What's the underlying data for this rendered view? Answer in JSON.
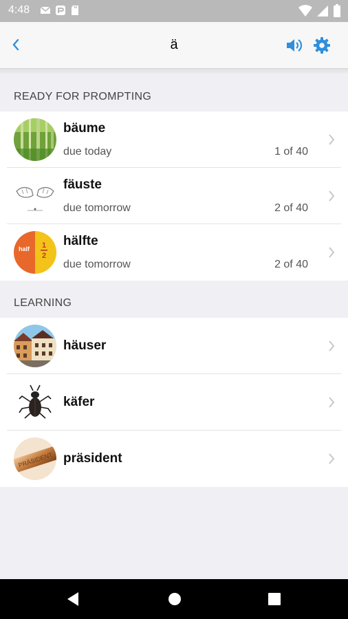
{
  "status_bar": {
    "time": "4:48",
    "left_icons": [
      "gmail-icon",
      "app-icon",
      "sd-card-icon"
    ],
    "right_icons": [
      "wifi-icon",
      "signal-icon",
      "battery-icon"
    ]
  },
  "header": {
    "title": "ä",
    "back_icon": "chevron-left-icon",
    "sound_icon": "speaker-icon",
    "settings_icon": "gear-icon",
    "accent_color": "#2f8fde"
  },
  "sections": [
    {
      "title": "READY FOR PROMPTING",
      "items": [
        {
          "word": "bäume",
          "due": "due today",
          "progress": "1 of 40",
          "image": "trees"
        },
        {
          "word": "fäuste",
          "due": "due tomorrow",
          "progress": "2 of 40",
          "image": "fists"
        },
        {
          "word": "hälfte",
          "due": "due tomorrow",
          "progress": "2 of 40",
          "image": "half"
        }
      ]
    },
    {
      "title": "LEARNING",
      "items": [
        {
          "word": "häuser",
          "image": "houses"
        },
        {
          "word": "käfer",
          "image": "beetle"
        },
        {
          "word": "präsident",
          "image": "plaque"
        }
      ]
    }
  ],
  "thumb_texts": {
    "half_word": "half",
    "half_num": "1",
    "half_den": "2",
    "plaque_word": "PRÄSIDENT"
  },
  "nav_bar": {
    "back": "back-triangle-icon",
    "home": "home-circle-icon",
    "recent": "recents-square-icon"
  }
}
